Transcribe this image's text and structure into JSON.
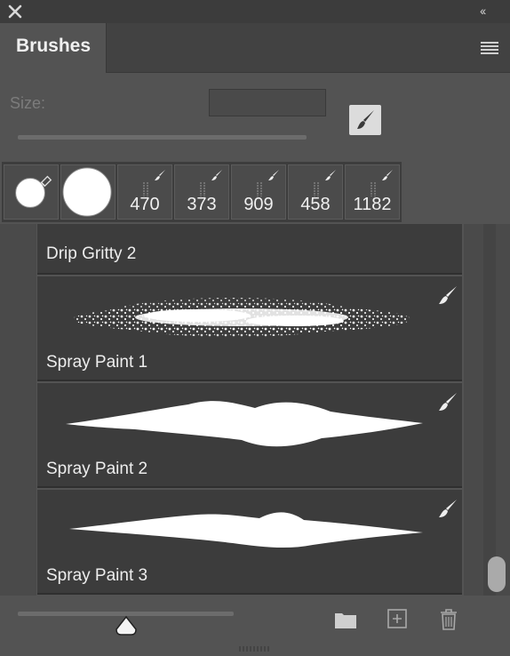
{
  "window": {
    "close_icon": "close-icon",
    "collapse_label": "‹‹"
  },
  "tab": {
    "label": "Brushes",
    "menu_icon": "hamburger-menu-icon"
  },
  "size": {
    "label": "Size:",
    "value": ""
  },
  "presets": [
    {
      "kind": "round-eraser",
      "number": ""
    },
    {
      "kind": "round-hard",
      "number": ""
    },
    {
      "kind": "brush",
      "number": "470"
    },
    {
      "kind": "brush",
      "number": "373"
    },
    {
      "kind": "brush",
      "number": "909"
    },
    {
      "kind": "brush",
      "number": "458"
    },
    {
      "kind": "brush",
      "number": "1182"
    }
  ],
  "brush_list": [
    {
      "name": "Drip Gritty 2"
    },
    {
      "name": "Spray Paint 1"
    },
    {
      "name": "Spray Paint 2"
    },
    {
      "name": "Spray Paint 3"
    }
  ],
  "footer": {
    "folder_icon": "folder-icon",
    "new_icon": "new-brush-icon",
    "trash_icon": "trash-icon"
  },
  "colors": {
    "panel": "#535353",
    "dark": "#3c3c3c",
    "accent": "#f0f0f0"
  }
}
